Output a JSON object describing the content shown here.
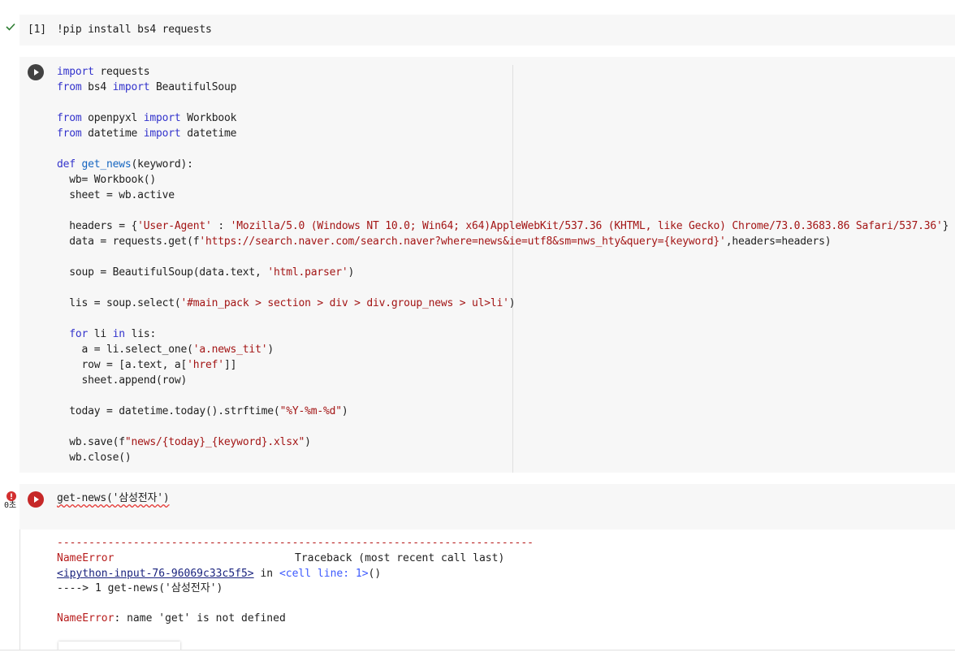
{
  "cell1": {
    "status_icon": "check-icon",
    "exec_count": "[1]",
    "code": "!pip install bs4 requests"
  },
  "cell2": {
    "lines": [
      [
        "import requests"
      ],
      [
        "from bs4 import BeautifulSoup"
      ],
      [
        ""
      ],
      [
        "from openpyxl import Workbook"
      ],
      [
        "from datetime import datetime"
      ],
      [
        ""
      ],
      [
        "def get_news(keyword):"
      ],
      [
        "  wb= Workbook()"
      ],
      [
        "  sheet = wb.active"
      ],
      [
        ""
      ],
      [
        "  headers = {'User-Agent' : 'Mozilla/5.0 (Windows NT 10.0; Win64; x64)AppleWebKit/537.36 (KHTML, like Gecko) Chrome/73.0.3683.86 Safari/537.36'}"
      ],
      [
        "  data = requests.get(f'https://search.naver.com/search.naver?where=news&ie=utf8&sm=nws_hty&query={keyword}',headers=headers)"
      ],
      [
        ""
      ],
      [
        "  soup = BeautifulSoup(data.text, 'html.parser')"
      ],
      [
        ""
      ],
      [
        "  lis = soup.select('#main_pack > section > div > div.group_news > ul>li')"
      ],
      [
        ""
      ],
      [
        "  for li in lis:"
      ],
      [
        "    a = li.select_one('a.news_tit')"
      ],
      [
        "    row = [a.text, a['href']]"
      ],
      [
        "    sheet.append(row)"
      ],
      [
        ""
      ],
      [
        "  today = datetime.today().strftime(\"%Y-%m-%d\")"
      ],
      [
        ""
      ],
      [
        "  wb.save(f\"news/{today}_{keyword}.xlsx\")"
      ],
      [
        "  wb.close()"
      ]
    ]
  },
  "cell3": {
    "status_icon": "error-icon",
    "duration": "0초",
    "code": "get-news('삼성전자')"
  },
  "output": {
    "rule": "---------------------------------------------------------------------------",
    "error_name": "NameError",
    "traceback_label": "Traceback (most recent call last)",
    "input_ref": "<ipython-input-76-96069c33c5f5>",
    "in_word": " in ",
    "cell_ref": "<cell line: 1>",
    "cell_ref_tail": "()",
    "arrow_line": "----> 1 get-news('삼성전자')",
    "error_final_name": "NameError",
    "error_message": ": name 'get' is not defined"
  },
  "colors": {
    "keyword": "#3333cc",
    "string": "#a31515",
    "error": "#b71c1c"
  }
}
